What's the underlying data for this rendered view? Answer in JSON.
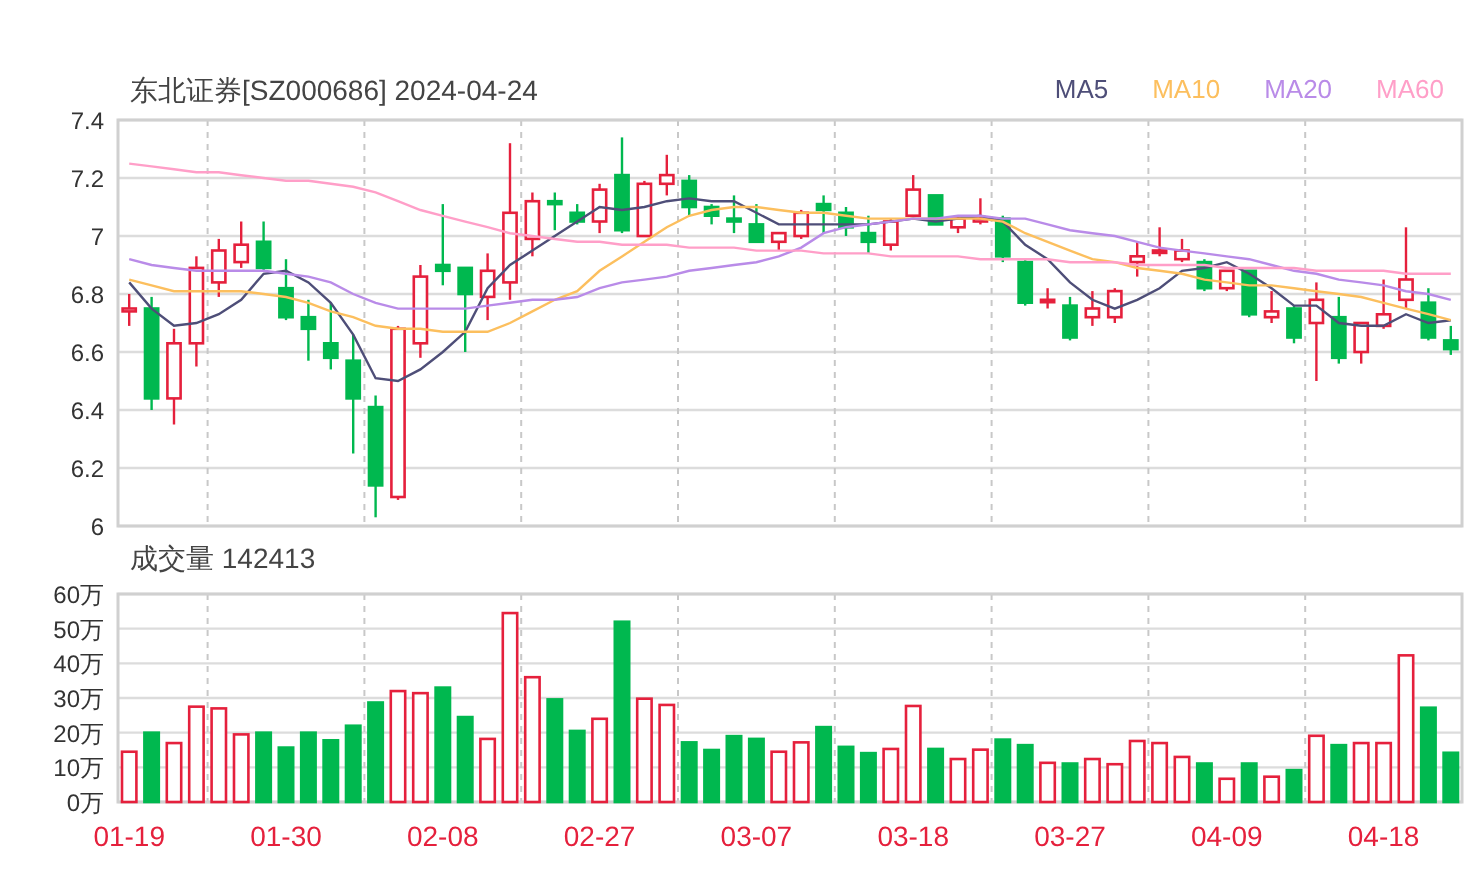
{
  "price_chart": {
    "chart_data": {
      "type": "candlestick",
      "title": "东北证券[SZ000686] 2024-04-24",
      "ylim": [
        6,
        7.4
      ],
      "yticks": [
        6,
        6.2,
        6.4,
        6.6,
        6.8,
        7,
        7.2,
        7.4
      ],
      "grid": true,
      "categories": [
        null,
        null,
        null,
        null,
        null,
        null,
        null,
        null,
        null,
        null,
        null,
        null,
        null,
        null,
        null,
        null,
        null,
        null,
        null,
        null,
        null,
        null,
        null,
        null,
        null,
        null,
        null,
        null,
        null,
        null,
        null,
        null,
        null,
        null,
        null,
        null,
        null,
        null,
        null,
        null,
        null,
        null,
        null,
        null,
        null,
        null,
        null,
        null,
        null,
        null,
        null,
        null,
        null,
        null,
        null,
        null,
        null,
        null,
        null,
        null
      ],
      "ohlc": [
        [
          6.74,
          6.8,
          6.69,
          6.75
        ],
        [
          6.75,
          6.79,
          6.4,
          6.44
        ],
        [
          6.44,
          6.68,
          6.35,
          6.63
        ],
        [
          6.63,
          6.93,
          6.55,
          6.89
        ],
        [
          6.84,
          6.99,
          6.79,
          6.95
        ],
        [
          6.91,
          7.05,
          6.89,
          6.97
        ],
        [
          6.98,
          7.05,
          6.88,
          6.89
        ],
        [
          6.82,
          6.92,
          6.71,
          6.72
        ],
        [
          6.72,
          6.78,
          6.57,
          6.68
        ],
        [
          6.63,
          6.77,
          6.54,
          6.58
        ],
        [
          6.57,
          6.66,
          6.25,
          6.44
        ],
        [
          6.41,
          6.45,
          6.03,
          6.14
        ],
        [
          6.1,
          6.69,
          6.09,
          6.68
        ],
        [
          6.63,
          6.9,
          6.58,
          6.86
        ],
        [
          6.9,
          7.11,
          6.83,
          6.88
        ],
        [
          6.89,
          6.89,
          6.6,
          6.8
        ],
        [
          6.79,
          6.94,
          6.71,
          6.88
        ],
        [
          6.84,
          7.32,
          6.78,
          7.08
        ],
        [
          6.99,
          7.15,
          6.93,
          7.12
        ],
        [
          7.12,
          7.15,
          7.02,
          7.11
        ],
        [
          7.08,
          7.11,
          7.04,
          7.05
        ],
        [
          7.05,
          7.18,
          7.01,
          7.16
        ],
        [
          7.21,
          7.34,
          7.01,
          7.02
        ],
        [
          7.0,
          7.19,
          7.0,
          7.18
        ],
        [
          7.18,
          7.28,
          7.14,
          7.21
        ],
        [
          7.19,
          7.21,
          7.07,
          7.1
        ],
        [
          7.1,
          7.11,
          7.04,
          7.07
        ],
        [
          7.06,
          7.14,
          7.01,
          7.05
        ],
        [
          7.04,
          7.11,
          6.98,
          6.98
        ],
        [
          6.98,
          7.01,
          6.95,
          7.01
        ],
        [
          7.0,
          7.09,
          6.99,
          7.08
        ],
        [
          7.11,
          7.14,
          7.01,
          7.09
        ],
        [
          7.08,
          7.1,
          7.0,
          7.03
        ],
        [
          7.01,
          7.07,
          6.94,
          6.98
        ],
        [
          6.97,
          7.06,
          6.95,
          7.05
        ],
        [
          7.07,
          7.21,
          7.07,
          7.16
        ],
        [
          7.14,
          7.14,
          7.04,
          7.04
        ],
        [
          7.03,
          7.07,
          7.01,
          7.06
        ],
        [
          7.05,
          7.13,
          7.04,
          7.06
        ],
        [
          7.06,
          7.07,
          6.91,
          6.93
        ],
        [
          6.91,
          6.92,
          6.76,
          6.77
        ],
        [
          6.78,
          6.82,
          6.75,
          6.78
        ],
        [
          6.76,
          6.79,
          6.64,
          6.65
        ],
        [
          6.72,
          6.81,
          6.69,
          6.75
        ],
        [
          6.72,
          6.82,
          6.7,
          6.81
        ],
        [
          6.91,
          6.98,
          6.86,
          6.93
        ],
        [
          6.95,
          7.03,
          6.93,
          6.95
        ],
        [
          6.92,
          6.99,
          6.91,
          6.95
        ],
        [
          6.91,
          6.92,
          6.81,
          6.82
        ],
        [
          6.82,
          6.88,
          6.81,
          6.88
        ],
        [
          6.88,
          6.88,
          6.72,
          6.73
        ],
        [
          6.72,
          6.81,
          6.7,
          6.74
        ],
        [
          6.75,
          6.76,
          6.63,
          6.65
        ],
        [
          6.7,
          6.84,
          6.5,
          6.78
        ],
        [
          6.72,
          6.79,
          6.56,
          6.58
        ],
        [
          6.6,
          6.7,
          6.56,
          6.7
        ],
        [
          6.69,
          6.85,
          6.68,
          6.73
        ],
        [
          6.78,
          7.03,
          6.75,
          6.85
        ],
        [
          6.77,
          6.82,
          6.64,
          6.65
        ],
        [
          6.64,
          6.69,
          6.59,
          6.61
        ]
      ],
      "series": [
        {
          "name": "MA5",
          "type": "line",
          "color": "#4e4e78",
          "values": [
            6.84,
            6.75,
            6.69,
            6.7,
            6.73,
            6.78,
            6.87,
            6.88,
            6.84,
            6.77,
            6.66,
            6.51,
            6.5,
            6.54,
            6.6,
            6.67,
            6.82,
            6.9,
            6.95,
            7.0,
            7.05,
            7.1,
            7.09,
            7.1,
            7.12,
            7.13,
            7.12,
            7.12,
            7.08,
            7.04,
            7.04,
            7.04,
            7.04,
            7.04,
            7.05,
            7.06,
            7.05,
            7.06,
            7.07,
            7.05,
            6.97,
            6.92,
            6.84,
            6.78,
            6.75,
            6.78,
            6.82,
            6.88,
            6.89,
            6.91,
            6.87,
            6.82,
            6.76,
            6.76,
            6.7,
            6.69,
            6.69,
            6.73,
            6.7,
            6.71
          ]
        },
        {
          "name": "MA10",
          "type": "line",
          "color": "#fcbf5e",
          "values": [
            6.85,
            6.83,
            6.81,
            6.81,
            6.81,
            6.81,
            6.8,
            6.79,
            6.77,
            6.74,
            6.72,
            6.69,
            6.68,
            6.68,
            6.67,
            6.67,
            6.67,
            6.7,
            6.74,
            6.78,
            6.81,
            6.88,
            6.93,
            6.98,
            7.03,
            7.07,
            7.09,
            7.1,
            7.1,
            7.09,
            7.08,
            7.08,
            7.07,
            7.06,
            7.06,
            7.06,
            7.06,
            7.06,
            7.06,
            7.05,
            7.01,
            6.98,
            6.95,
            6.92,
            6.91,
            6.89,
            6.88,
            6.87,
            6.85,
            6.84,
            6.83,
            6.83,
            6.82,
            6.81,
            6.8,
            6.79,
            6.77,
            6.75,
            6.73,
            6.71
          ]
        },
        {
          "name": "MA20",
          "type": "line",
          "color": "#b98be8",
          "values": [
            6.92,
            6.9,
            6.89,
            6.88,
            6.88,
            6.88,
            6.88,
            6.87,
            6.86,
            6.84,
            6.8,
            6.77,
            6.75,
            6.75,
            6.75,
            6.75,
            6.76,
            6.77,
            6.78,
            6.78,
            6.79,
            6.82,
            6.84,
            6.85,
            6.86,
            6.88,
            6.89,
            6.9,
            6.91,
            6.93,
            6.96,
            7.01,
            7.03,
            7.04,
            7.05,
            7.06,
            7.06,
            7.07,
            7.07,
            7.06,
            7.06,
            7.04,
            7.02,
            7.01,
            7.0,
            6.98,
            6.96,
            6.95,
            6.94,
            6.93,
            6.92,
            6.9,
            6.88,
            6.87,
            6.85,
            6.84,
            6.83,
            6.81,
            6.8,
            6.78
          ]
        },
        {
          "name": "MA60",
          "type": "line",
          "color": "#ff9fc8",
          "values": [
            7.25,
            7.24,
            7.23,
            7.22,
            7.22,
            7.21,
            7.2,
            7.19,
            7.19,
            7.18,
            7.17,
            7.15,
            7.12,
            7.09,
            7.07,
            7.05,
            7.03,
            7.01,
            7.0,
            6.99,
            6.98,
            6.98,
            6.97,
            6.97,
            6.97,
            6.96,
            6.96,
            6.96,
            6.95,
            6.95,
            6.95,
            6.94,
            6.94,
            6.94,
            6.93,
            6.93,
            6.93,
            6.93,
            6.92,
            6.92,
            6.92,
            6.92,
            6.91,
            6.91,
            6.91,
            6.9,
            6.9,
            6.9,
            6.9,
            6.89,
            6.89,
            6.89,
            6.89,
            6.88,
            6.88,
            6.88,
            6.88,
            6.87,
            6.87,
            6.87
          ]
        }
      ]
    }
  },
  "volume_chart": {
    "chart_data": {
      "type": "bar",
      "title": "成交量 142413",
      "ylim": [
        0,
        60
      ],
      "grid": true,
      "yticks": [
        {
          "value": 0,
          "label": "0万"
        },
        {
          "value": 10,
          "label": "10万"
        },
        {
          "value": 20,
          "label": "20万"
        },
        {
          "value": 30,
          "label": "30万"
        },
        {
          "value": 40,
          "label": "40万"
        },
        {
          "value": 50,
          "label": "50万"
        },
        {
          "value": 60,
          "label": "60万"
        }
      ],
      "categories": [
        "01-19",
        null,
        null,
        null,
        null,
        null,
        null,
        "01-30",
        null,
        null,
        null,
        null,
        null,
        null,
        "02-08",
        null,
        null,
        null,
        null,
        null,
        null,
        "02-27",
        null,
        null,
        null,
        null,
        null,
        null,
        "03-07",
        null,
        null,
        null,
        null,
        null,
        null,
        "03-18",
        null,
        null,
        null,
        null,
        null,
        null,
        "03-27",
        null,
        null,
        null,
        null,
        null,
        null,
        "04-09",
        null,
        null,
        null,
        null,
        null,
        null,
        "04-18",
        null,
        null,
        null
      ],
      "values": [
        14.5,
        20,
        17,
        27.5,
        27,
        19.5,
        20,
        15.7,
        20,
        17.8,
        22,
        28.7,
        32,
        31.4,
        33,
        24.5,
        18.2,
        54.5,
        36,
        29.6,
        20.5,
        24,
        52,
        29.8,
        28,
        17.2,
        15,
        19,
        18.2,
        14.5,
        17.2,
        21.6,
        15.9,
        14.1,
        15.3,
        27.7,
        15.3,
        12.4,
        15.1,
        18,
        16.4,
        11.3,
        11.1,
        12.4,
        10.9,
        17.6,
        17,
        13,
        11.1,
        6.7,
        11.1,
        7.3,
        9.2,
        19.1,
        16.4,
        17,
        17,
        42.3,
        27.2,
        14.2
      ]
    }
  }
}
